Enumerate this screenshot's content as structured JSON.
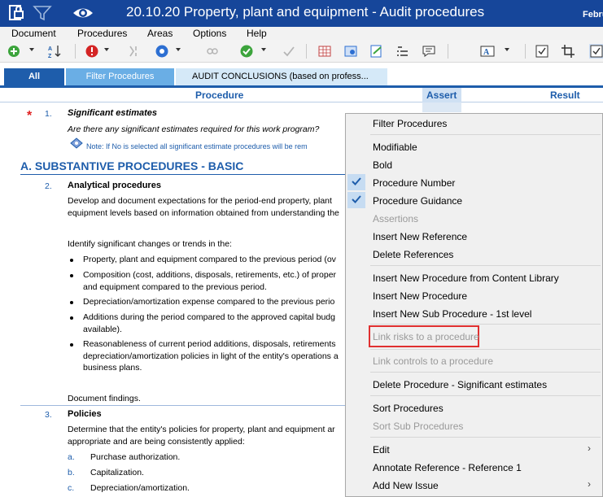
{
  "window": {
    "title": "20.10.20 Property, plant and equipment - Audit procedures",
    "date_fragment": "Febru",
    "icons": [
      "document-lock-icon",
      "filter-icon",
      "eye-icon"
    ]
  },
  "menubar": {
    "items": [
      "Document",
      "Procedures",
      "Areas",
      "Options",
      "Help"
    ]
  },
  "toolbar": {
    "icons": [
      "add-circle-icon",
      "sort-az-icon",
      "exclamation-icon",
      "mark-icon",
      "circle-icon",
      "link-icon",
      "check-icon",
      "signoff-icon",
      "grid-icon",
      "view-icon",
      "edit-doc-icon",
      "list-icon",
      "comment-icon",
      "font-icon",
      "checkbox-icon",
      "crop-icon"
    ]
  },
  "tabs": {
    "all": "All",
    "filter": "Filter Procedures",
    "audit": "AUDIT CONCLUSIONS (based on profess..."
  },
  "columns": {
    "procedure": "Procedure",
    "assert": "Assert",
    "result": "Result"
  },
  "procedures": {
    "p1": {
      "number": "1.",
      "title": "Significant estimates",
      "question": "Are there any significant estimates required for this work program?",
      "note": "Note: If No is selected all significant estimate procedures will be rem"
    },
    "sectionA": "A. SUBSTANTIVE PROCEDURES - BASIC",
    "p2": {
      "number": "2.",
      "title": "Analytical procedures",
      "line1": "Develop and document expectations for the period-end property, plant",
      "line2": "equipment levels based on information obtained from understanding the",
      "identify": "Identify significant changes or trends in the:",
      "b1": "Property, plant and equipment compared to the previous period (ov",
      "b2a": "Composition (cost, additions, disposals, retirements, etc.) of proper",
      "b2b": "and equipment compared to the previous period.",
      "b3": "Depreciation/amortization expense compared to the previous perio",
      "b4a": "Additions during the period compared to the approved capital budg",
      "b4b": "available).",
      "b5a": "Reasonableness of current period additions, disposals, retirements",
      "b5b": "depreciation/amortization policies in light of the entity's operations a",
      "b5c": "business plans.",
      "findings": "Document findings."
    },
    "p3": {
      "number": "3.",
      "title": "Policies",
      "line1": "Determine that the entity's policies for property, plant and equipment ar",
      "line2": "appropriate and are being consistently applied:",
      "a_letter": "a.",
      "a_text": "Purchase authorization.",
      "b_letter": "b.",
      "b_text": "Capitalization.",
      "c_letter": "c.",
      "c_text": "Depreciation/amortization."
    }
  },
  "context_menu": {
    "filter_procedures": "Filter Procedures",
    "modifiable": "Modifiable",
    "bold": "Bold",
    "procedure_number": "Procedure Number",
    "procedure_guidance": "Procedure Guidance",
    "assertions": "Assertions",
    "insert_new_reference": "Insert New Reference",
    "delete_references": "Delete References",
    "insert_from_library": "Insert New Procedure from Content Library",
    "insert_new_procedure": "Insert New Procedure",
    "insert_sub_procedure": "Insert New Sub Procedure - 1st level",
    "link_risks": "Link risks to a procedure",
    "link_controls": "Link controls to a procedure",
    "delete_procedure": "Delete Procedure - Significant estimates",
    "sort_procedures": "Sort Procedures",
    "sort_sub_procedures": "Sort Sub Procedures",
    "edit": "Edit",
    "annotate_reference": "Annotate Reference  - Reference 1",
    "add_new_issue": "Add New Issue"
  },
  "colors": {
    "title_bar": "#16469a",
    "accent_blue": "#1e5dab",
    "tab_light": "#6aaee5",
    "highlight_red": "#e03030",
    "required_star": "#e02020"
  }
}
